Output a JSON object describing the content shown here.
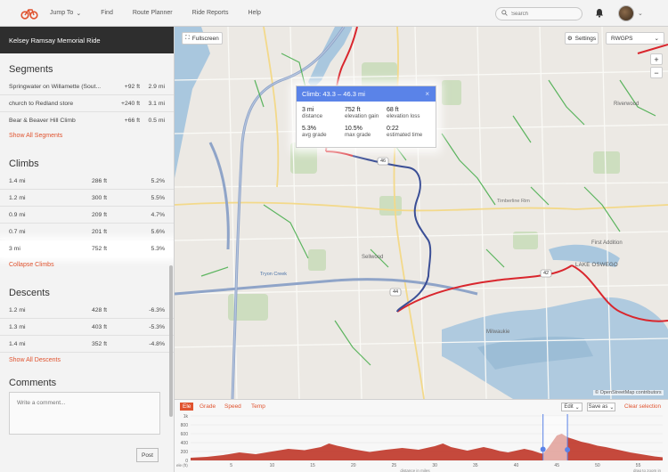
{
  "nav": {
    "links": [
      {
        "label": "Jump To"
      },
      {
        "label": "Find"
      },
      {
        "label": "Route Planner"
      },
      {
        "label": "Ride Reports"
      },
      {
        "label": "Help"
      }
    ],
    "search_placeholder": "Search"
  },
  "left": {
    "title": "Kelsey Ramsay Memorial Ride",
    "segments": {
      "heading": "Segments",
      "rows": [
        {
          "name": "Springwater on Willamette (Sout...",
          "gain": "+92 ft",
          "dist": "2.9 mi"
        },
        {
          "name": "church to Redland store",
          "gain": "+240 ft",
          "dist": "3.1 mi"
        },
        {
          "name": "Bear & Beaver Hill Climb",
          "gain": "+66 ft",
          "dist": "0.5 mi"
        }
      ],
      "show_all": "Show All Segments"
    },
    "climbs": {
      "heading": "Climbs",
      "rows": [
        {
          "dist": "1.4 mi",
          "gain": "286 ft",
          "grade": "5.2%"
        },
        {
          "dist": "1.2 mi",
          "gain": "300 ft",
          "grade": "5.5%"
        },
        {
          "dist": "0.9 mi",
          "gain": "209 ft",
          "grade": "4.7%"
        },
        {
          "dist": "0.7 mi",
          "gain": "201 ft",
          "grade": "5.6%"
        },
        {
          "dist": "3 mi",
          "gain": "752 ft",
          "grade": "5.3%"
        }
      ],
      "collapse": "Collapse Climbs"
    },
    "descents": {
      "heading": "Descents",
      "rows": [
        {
          "dist": "1.2 mi",
          "loss": "428 ft",
          "grade": "-6.3%"
        },
        {
          "dist": "1.3 mi",
          "loss": "403 ft",
          "grade": "-5.3%"
        },
        {
          "dist": "1.4 mi",
          "loss": "352 ft",
          "grade": "-4.8%"
        }
      ],
      "show_all": "Show All Descents"
    },
    "comments": {
      "heading": "Comments",
      "placeholder": "Write a comment...",
      "post": "Post"
    }
  },
  "map": {
    "fullscreen": "Fullscreen",
    "settings": "Settings",
    "layer": "RWGPS",
    "zoom_in": "+",
    "zoom_out": "−",
    "attribution": "© OpenStreetMap contributors",
    "labels": {
      "riverwood": "Riverwood",
      "lake_oswego": "LAKE OSWEGO",
      "first_addition": "First Addition",
      "timberline": "Timberline Rim",
      "sellwood": "Sellwood",
      "milwaukie": "Milwaukie",
      "tryon": "Tryon Creek"
    },
    "shields": [
      "46",
      "44",
      "42"
    ],
    "popup": {
      "title": "Climb: 43.3 – 46.3 mi",
      "close": "×",
      "stats": [
        {
          "value": "3 mi",
          "label": "distance"
        },
        {
          "value": "752 ft",
          "label": "elevation gain"
        },
        {
          "value": "68 ft",
          "label": "elevation loss"
        },
        {
          "value": "5.3%",
          "label": "avg grade"
        },
        {
          "value": "10.5%",
          "label": "max grade"
        },
        {
          "value": "0:22",
          "label": "estimated time"
        }
      ]
    }
  },
  "elevation": {
    "tabs": [
      "Ele",
      "Grade",
      "Speed",
      "Temp"
    ],
    "edit": "Edit",
    "save_as": "Save as",
    "clear": "Clear selection",
    "y_ticks": [
      "1k",
      "800",
      "600",
      "400",
      "200",
      "0"
    ],
    "x_ticks": [
      "5",
      "10",
      "15",
      "20",
      "25",
      "30",
      "35",
      "40",
      "45",
      "50",
      "55"
    ],
    "y_unit": "ele (ft)",
    "x_caption": "distance in miles",
    "x_caption_right": "drag to zoom in",
    "selection_range": [
      43.3,
      46.3
    ],
    "colors": {
      "fill": "#c0392b",
      "route": "#d9262d",
      "accent": "#e0532f",
      "popup": "#5a83e8"
    }
  }
}
